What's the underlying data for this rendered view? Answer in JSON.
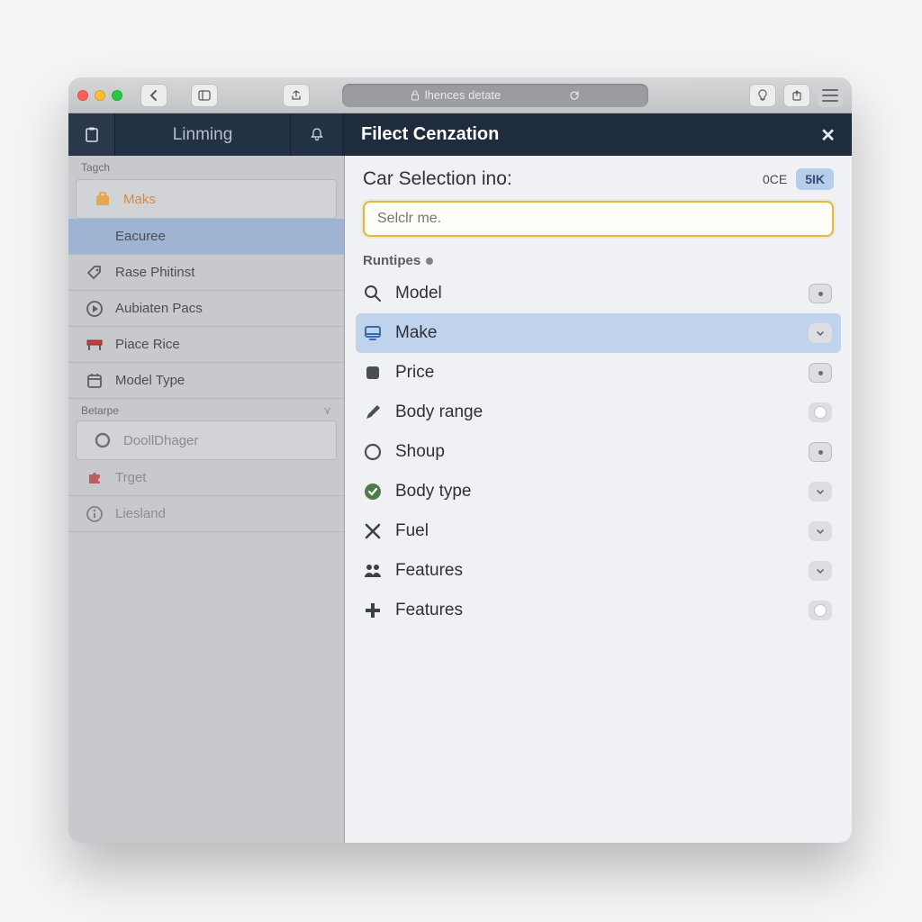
{
  "titlebar": {
    "url_text": "lhences detate"
  },
  "tabs": {
    "main_label": "Linming"
  },
  "panel": {
    "header": "Filect Cenzation",
    "title": "Car Selection ino:",
    "pill_label": "0CE",
    "button_label": "5IK",
    "search_placeholder": "Selclr me.",
    "list_heading": "Runtipes"
  },
  "options": [
    {
      "label": "Model",
      "icon": "search",
      "chip": "dot"
    },
    {
      "label": "Make",
      "icon": "monitor",
      "chip": "chev",
      "hl": true
    },
    {
      "label": "Price",
      "icon": "square",
      "chip": "dot"
    },
    {
      "label": "Body range",
      "icon": "pencil",
      "chip": "sw"
    },
    {
      "label": "Shoup",
      "icon": "circle",
      "chip": "dot"
    },
    {
      "label": "Body type",
      "icon": "check",
      "chip": "chev"
    },
    {
      "label": "Fuel",
      "icon": "cross",
      "chip": "chev"
    },
    {
      "label": "Features",
      "icon": "people",
      "chip": "chev"
    },
    {
      "label": "Features",
      "icon": "plus",
      "chip": "sw"
    }
  ],
  "sidebar": {
    "section1_label": "Tagch",
    "section2_label": "Betarpe",
    "items1": [
      {
        "label": "Maks",
        "icon": "bag",
        "style": "orange boxed"
      },
      {
        "label": "Eacuree",
        "icon": "",
        "style": "selected"
      },
      {
        "label": "Rase Phitinst",
        "icon": "tag",
        "style": ""
      },
      {
        "label": "Aubiaten Pacs",
        "icon": "play",
        "style": ""
      },
      {
        "label": "Piace Rice",
        "icon": "barrier",
        "style": ""
      },
      {
        "label": "Model Type",
        "icon": "calendar",
        "style": ""
      }
    ],
    "items2": [
      {
        "label": "DoollDhager",
        "icon": "ring",
        "style": "boxed muted"
      },
      {
        "label": "Trget",
        "icon": "puzzle",
        "style": "muted"
      },
      {
        "label": "Liesland",
        "icon": "info",
        "style": "muted"
      }
    ]
  }
}
